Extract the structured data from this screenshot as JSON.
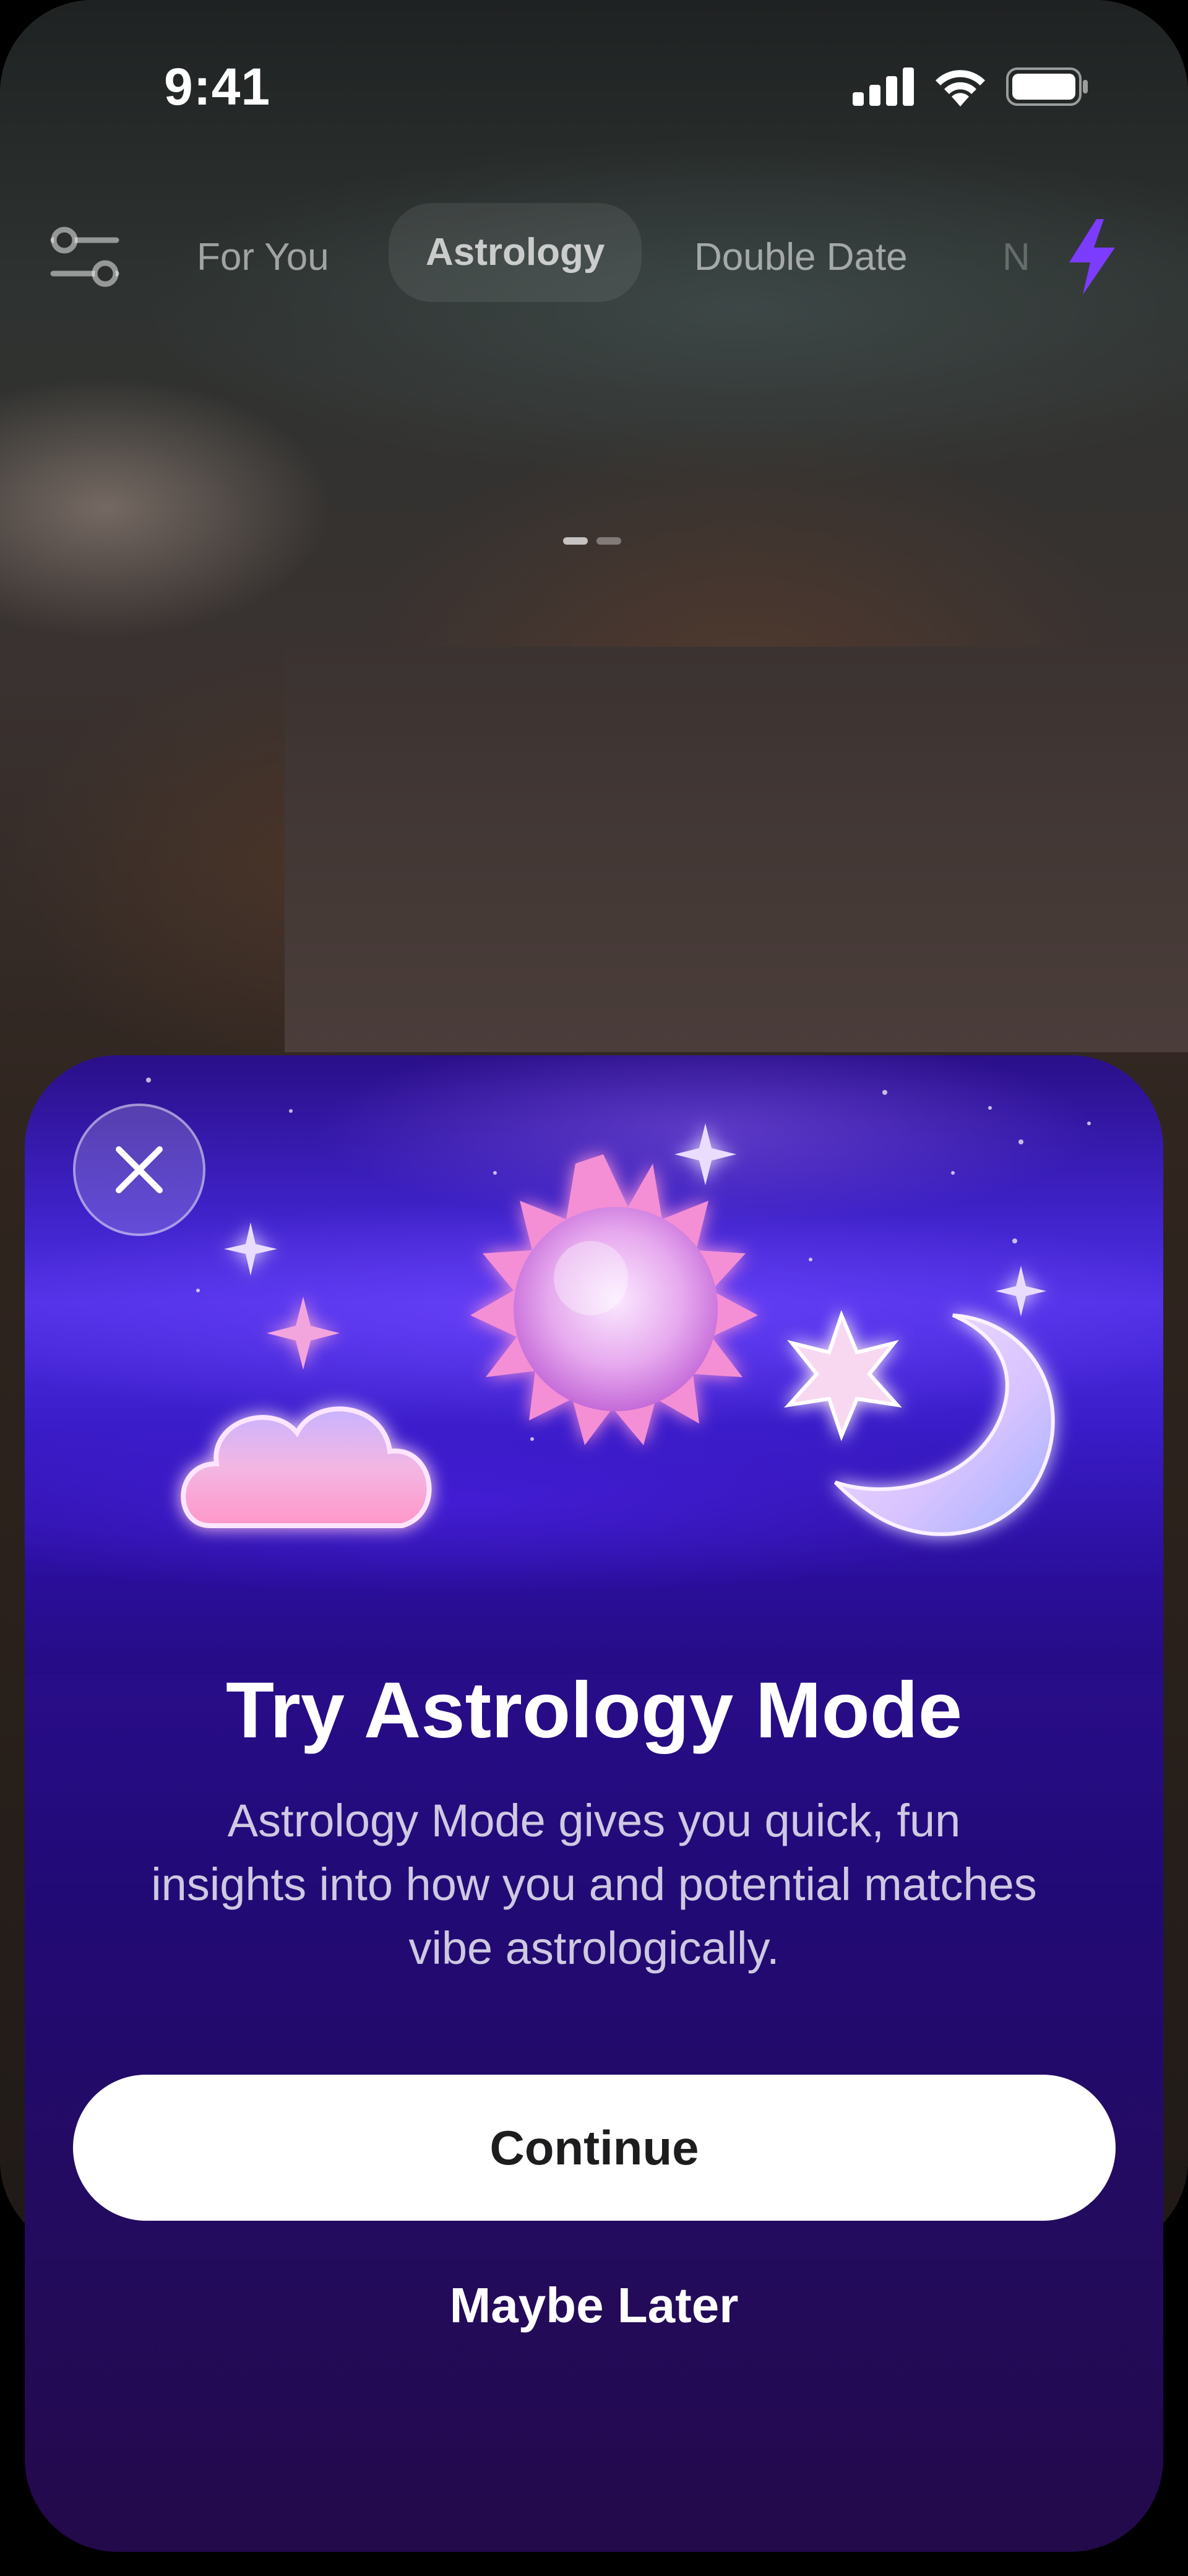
{
  "status_bar": {
    "time": "9:41",
    "signal_icon": "cellular-signal-icon",
    "wifi_icon": "wifi-icon",
    "battery_icon": "battery-icon"
  },
  "top_nav": {
    "filter_icon": "filter-sliders-icon",
    "tabs": [
      {
        "label": "For You",
        "active": false
      },
      {
        "label": "Astrology",
        "active": true
      },
      {
        "label": "Double Date",
        "active": false
      },
      {
        "label": "N",
        "active": false
      }
    ],
    "boost_icon": "lightning-bolt-icon",
    "pager": {
      "count": 2,
      "active_index": 0
    }
  },
  "modal": {
    "close_icon": "close-icon",
    "illustration_icons": [
      "sparkle-icon",
      "cloud-icon",
      "sun-icon",
      "star-icon",
      "crescent-moon-icon"
    ],
    "title": "Try Astrology Mode",
    "body_lines": [
      "Astrology Mode gives you quick, fun",
      "insights into how you and potential matches",
      "vibe astrologically."
    ],
    "primary_button": "Continue",
    "secondary_button": "Maybe Later"
  },
  "colors": {
    "modal_top": "#3f22c8",
    "modal_bottom": "#230a4a",
    "accent_purple": "#7b3cff",
    "button_bg": "#ffffff",
    "button_text": "#1d1d1f"
  }
}
